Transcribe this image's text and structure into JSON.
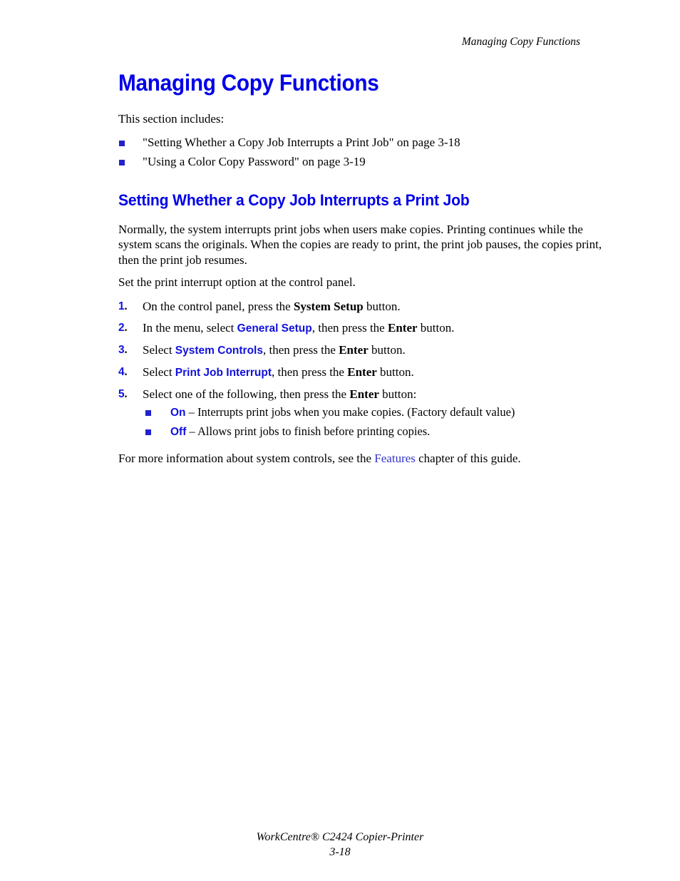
{
  "header": {
    "running_title": "Managing Copy Functions"
  },
  "document": {
    "chapter_title": "Managing Copy Functions",
    "intro": "This section includes:",
    "toc_items": [
      "\"Setting Whether a Copy Job Interrupts a Print Job\" on page 3-18",
      "\"Using a Color Copy Password\" on page 3-19"
    ],
    "section_title": "Setting Whether a Copy Job Interrupts a Print Job",
    "paragraph_1": "Normally, the system interrupts print jobs when users make copies. Printing continues while the system scans the originals. When the copies are ready to print, the print job pauses, the copies print, then the print job resumes.",
    "paragraph_2": "Set the print interrupt option at the control panel.",
    "steps": [
      {
        "number": "1",
        "dot": ".",
        "text_before": "On the control panel, press the ",
        "emphasis": "System Setup",
        "emphasis_style": "bold-serif",
        "text_after": " button."
      },
      {
        "number": "2",
        "dot": ".",
        "text_before": "In the menu, select ",
        "emphasis": "General Setup",
        "emphasis_style": "ui-term",
        "text_mid": ", then press the ",
        "emphasis_2": "Enter",
        "text_after": " button."
      },
      {
        "number": "3",
        "dot": ".",
        "text_before": "Select ",
        "emphasis": "System Controls",
        "emphasis_style": "ui-term",
        "text_mid": ", then press the ",
        "emphasis_2": "Enter",
        "text_after": " button."
      },
      {
        "number": "4",
        "dot": ".",
        "text_before": "Select ",
        "emphasis": "Print Job Interrupt",
        "emphasis_style": "ui-term",
        "text_mid": ", then press the ",
        "emphasis_2": "Enter",
        "text_after": " button."
      },
      {
        "number": "5",
        "dot": ".",
        "text_before": "Select one of the following, then press the ",
        "emphasis_2": "Enter",
        "text_after": " button:"
      }
    ],
    "options": [
      {
        "label": "On",
        "description": " – Interrupts print jobs when you make copies. (Factory default value)"
      },
      {
        "label": "Off",
        "description": " – Allows print jobs to finish before printing copies."
      }
    ],
    "closing": {
      "text_before": "For more information about system controls, see the ",
      "link": "Features",
      "text_after": " chapter of this guide."
    }
  },
  "footer": {
    "product": "WorkCentre® C2424 Copier-Printer",
    "page_number": "3-18"
  },
  "colors": {
    "heading_blue": "#0000E8",
    "ui_term_blue": "#1111DD",
    "bullet_blue": "#2222CC",
    "link_blue": "#3333CC",
    "text_black": "#000000",
    "background": "#FFFFFF"
  }
}
